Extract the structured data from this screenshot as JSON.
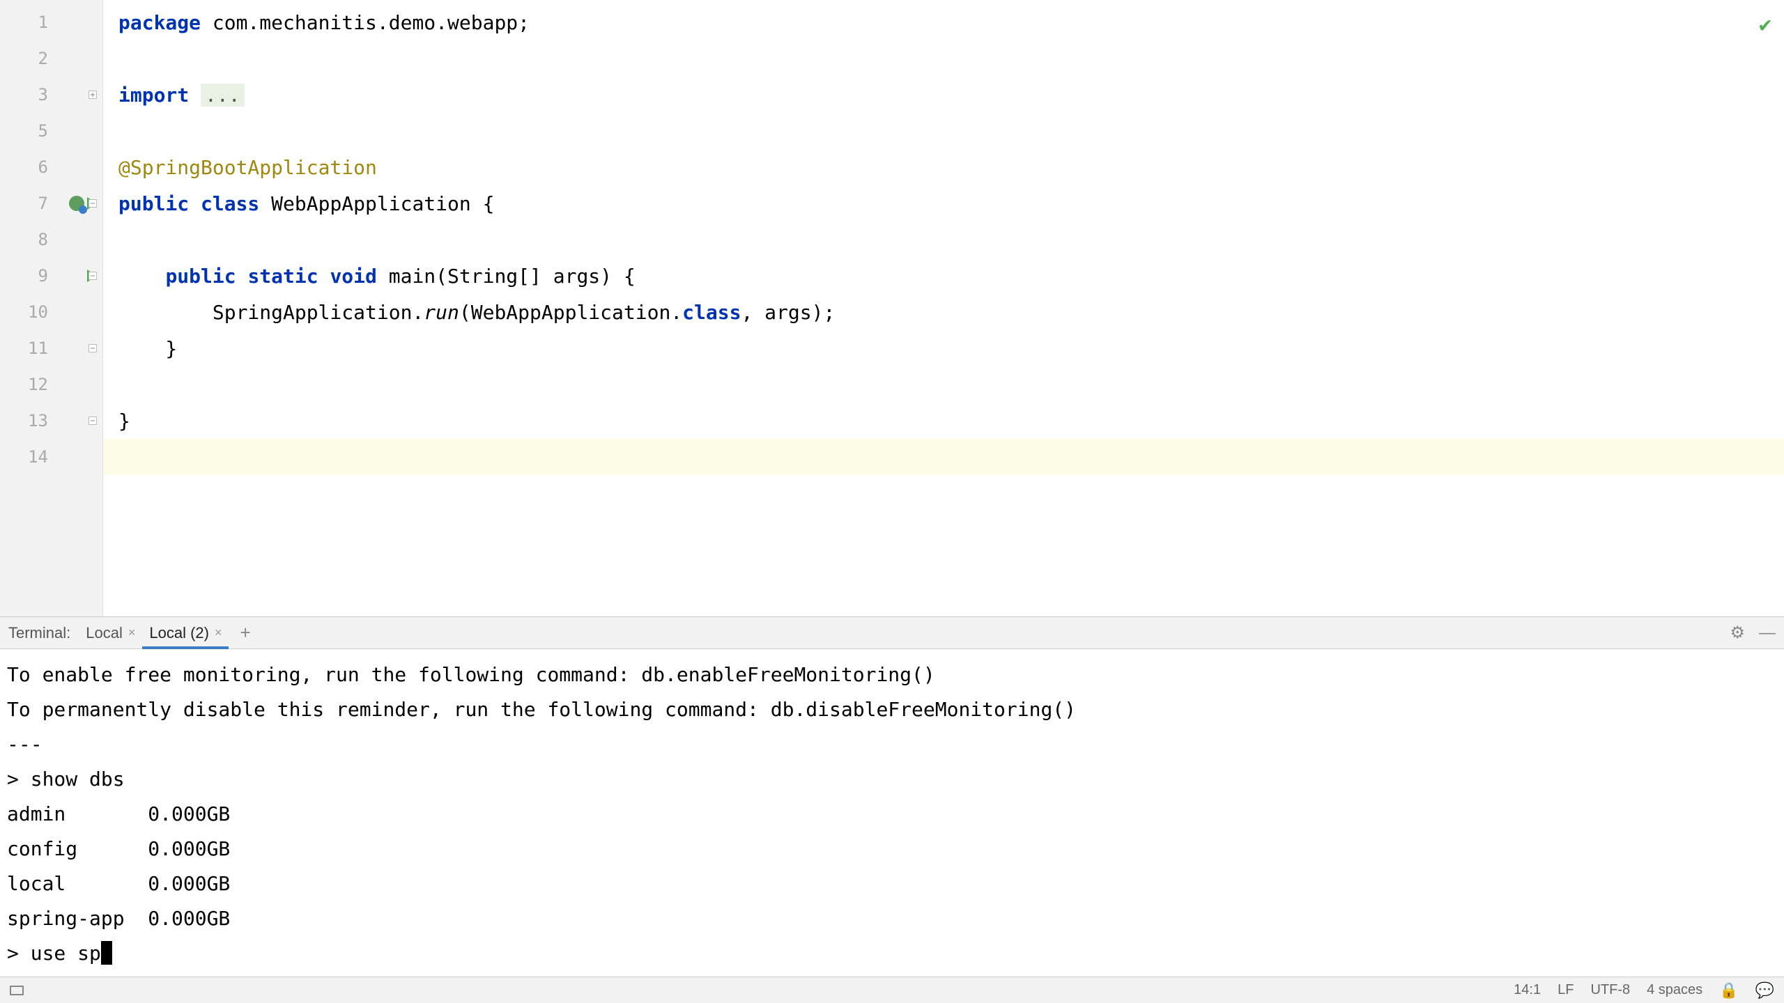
{
  "editor": {
    "lines": [
      {
        "num": "1",
        "segments": [
          {
            "t": "package ",
            "c": "kw"
          },
          {
            "t": "com.mechanitis.demo.webapp;",
            "c": ""
          }
        ]
      },
      {
        "num": "2",
        "segments": []
      },
      {
        "num": "3",
        "segments": [
          {
            "t": "import ",
            "c": "kw"
          },
          {
            "t": "...",
            "c": "folded"
          }
        ],
        "fold": "plus"
      },
      {
        "num": "5",
        "segments": []
      },
      {
        "num": "6",
        "segments": [
          {
            "t": "@SpringBootApplication",
            "c": "ann"
          }
        ],
        "badge": "class"
      },
      {
        "num": "7",
        "segments": [
          {
            "t": "public class ",
            "c": "kw"
          },
          {
            "t": "WebAppApplication {",
            "c": "cls"
          }
        ],
        "run": true,
        "fold": "minus",
        "classBadge": true
      },
      {
        "num": "8",
        "segments": []
      },
      {
        "num": "9",
        "segments": [
          {
            "t": "    ",
            "c": ""
          },
          {
            "t": "public static void ",
            "c": "kw"
          },
          {
            "t": "main(String[] args) {",
            "c": "cls"
          }
        ],
        "run": true,
        "fold": "minus"
      },
      {
        "num": "10",
        "segments": [
          {
            "t": "        SpringApplication.",
            "c": ""
          },
          {
            "t": "run",
            "c": "method-italic"
          },
          {
            "t": "(WebAppApplication.",
            "c": ""
          },
          {
            "t": "class",
            "c": "kw2"
          },
          {
            "t": ", args);",
            "c": ""
          }
        ]
      },
      {
        "num": "11",
        "segments": [
          {
            "t": "    }",
            "c": ""
          }
        ],
        "fold": "minus"
      },
      {
        "num": "12",
        "segments": []
      },
      {
        "num": "13",
        "segments": [
          {
            "t": "}",
            "c": ""
          }
        ],
        "fold": "minus"
      },
      {
        "num": "14",
        "segments": [],
        "hl": true
      }
    ]
  },
  "terminal": {
    "label": "Terminal:",
    "tabs": [
      "Local",
      "Local (2)"
    ],
    "active_tab": 1,
    "output": [
      "To enable free monitoring, run the following command: db.enableFreeMonitoring()",
      "To permanently disable this reminder, run the following command: db.disableFreeMonitoring()",
      "---",
      "",
      "> show dbs",
      "admin       0.000GB",
      "config      0.000GB",
      "local       0.000GB",
      "spring-app  0.000GB"
    ],
    "prompt": "> use sp"
  },
  "status": {
    "pos": "14:1",
    "eol": "LF",
    "encoding": "UTF-8",
    "indent": "4 spaces"
  }
}
